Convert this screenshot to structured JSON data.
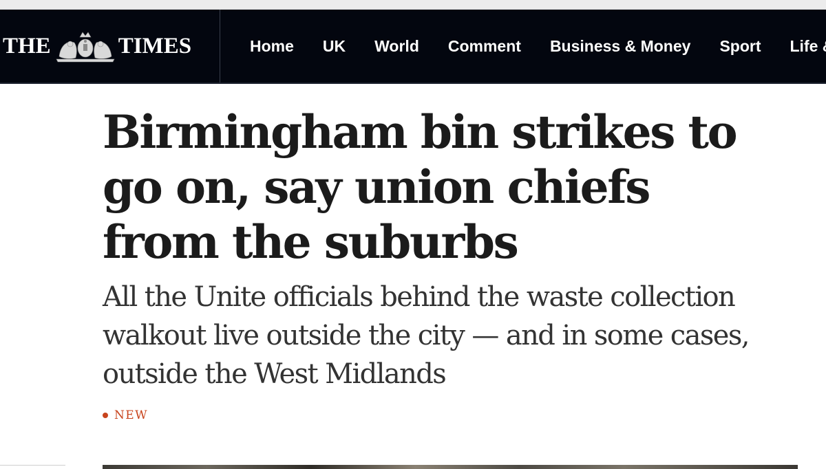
{
  "masthead": {
    "logo_left": "THE",
    "logo_right": "TIMES",
    "crest_icon": "royal-crest-icon"
  },
  "nav": {
    "items": [
      {
        "label": "Home"
      },
      {
        "label": "UK"
      },
      {
        "label": "World"
      },
      {
        "label": "Comment"
      },
      {
        "label": "Business & Money"
      },
      {
        "label": "Sport"
      },
      {
        "label": "Life &"
      }
    ]
  },
  "article": {
    "headline": "Birmingham bin strikes to go on, say union chiefs from the suburbs",
    "standfirst": "All the Unite officials behind the waste collection walkout live outside the city — and in some cases, outside the West Midlands",
    "badge": "NEW"
  },
  "colors": {
    "masthead_bg": "#03060f",
    "badge": "#c8441d",
    "headline": "#1b1b1b"
  }
}
